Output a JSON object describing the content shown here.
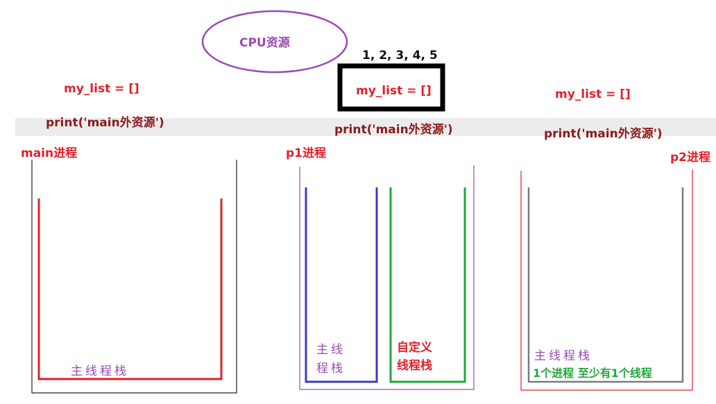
{
  "cpu": {
    "label": "CPU资源",
    "color": "#9a4ab2"
  },
  "shared_values": "1, 2, 3, 4, 5",
  "main_process": {
    "var": "my_list = []",
    "print": "print('main外资源')",
    "title": "main进程",
    "stack_label": "主线程栈"
  },
  "p1_process": {
    "var": "my_list = []",
    "print": "print('main外资源')",
    "title": "p1进程",
    "main_stack_label_line1": "主线",
    "main_stack_label_line2": "程栈",
    "custom_stack_label_line1": "自定义",
    "custom_stack_label_line2": "线程栈"
  },
  "p2_process": {
    "var": "my_list = []",
    "print": "print('main外资源')",
    "title": "p2进程",
    "stack_label": "主线程栈",
    "note": "1个进程 至少有1个线程"
  },
  "colors": {
    "red": "#e0202a",
    "dark_red": "#8b1a1a",
    "blue": "#3b3bb8",
    "green": "#1fa83a",
    "purple": "#9a4ab2",
    "gray": "#7a7a7a",
    "black": "#111111"
  }
}
